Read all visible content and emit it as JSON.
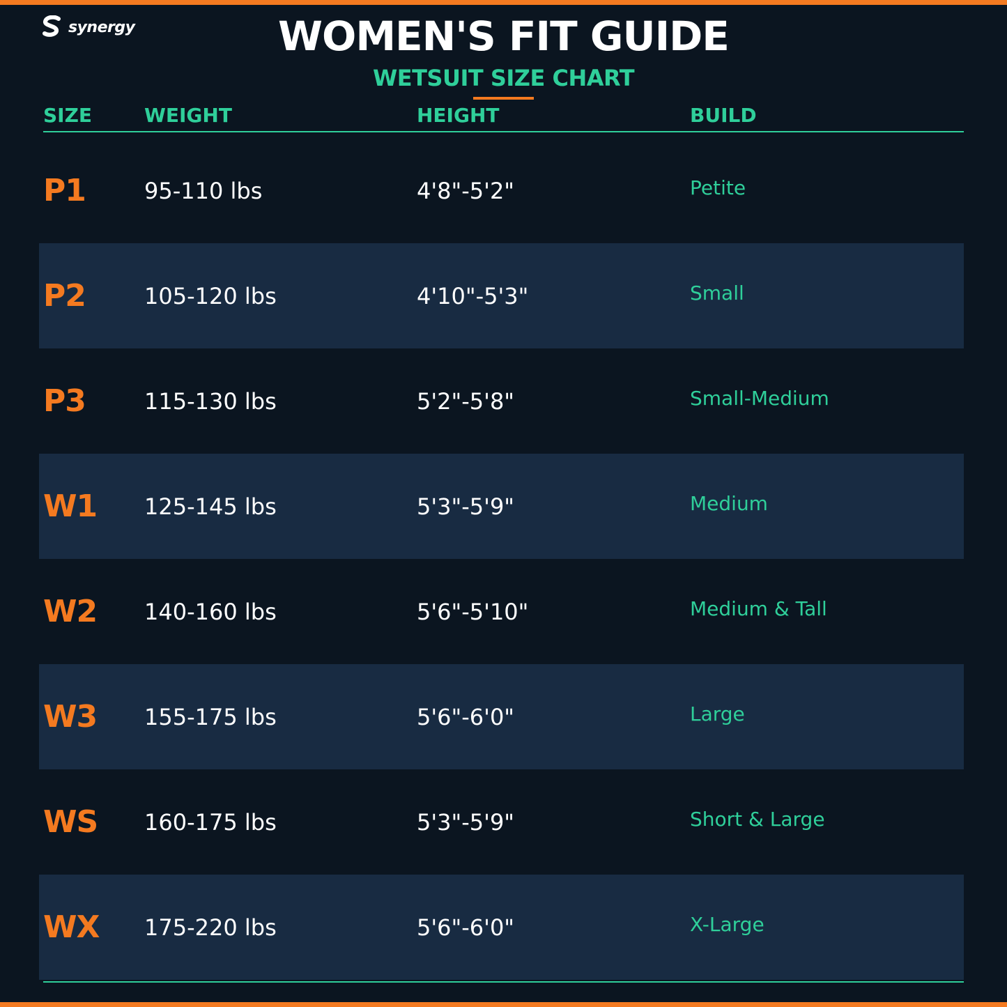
{
  "brand": {
    "name": "synergy",
    "logo_icon": "s-swoosh-icon"
  },
  "title": "WOMEN'S FIT GUIDE",
  "subtitle": "WETSUIT SIZE CHART",
  "colors": {
    "accent": "#f47a20",
    "teal": "#2fcf9a",
    "background": "#0b1520",
    "row_shade": "#182b42"
  },
  "headers": {
    "size": "SIZE",
    "weight": "WEIGHT",
    "height": "HEIGHT",
    "build": "BUILD"
  },
  "rows": [
    {
      "size": "P1",
      "weight": "95-110 lbs",
      "height": "4'8\"-5'2\"",
      "build": "Petite"
    },
    {
      "size": "P2",
      "weight": "105-120 lbs",
      "height": "4'10\"-5'3\"",
      "build": "Small"
    },
    {
      "size": "P3",
      "weight": "115-130 lbs",
      "height": "5'2\"-5'8\"",
      "build": "Small-Medium"
    },
    {
      "size": "W1",
      "weight": "125-145 lbs",
      "height": "5'3\"-5'9\"",
      "build": "Medium"
    },
    {
      "size": "W2",
      "weight": "140-160 lbs",
      "height": "5'6\"-5'10\"",
      "build": "Medium & Tall"
    },
    {
      "size": "W3",
      "weight": "155-175 lbs",
      "height": "5'6\"-6'0\"",
      "build": "Large"
    },
    {
      "size": "WS",
      "weight": "160-175 lbs",
      "height": "5'3\"-5'9\"",
      "build": "Short & Large"
    },
    {
      "size": "WX",
      "weight": "175-220 lbs",
      "height": "5'6\"-6'0\"",
      "build": "X-Large"
    }
  ]
}
